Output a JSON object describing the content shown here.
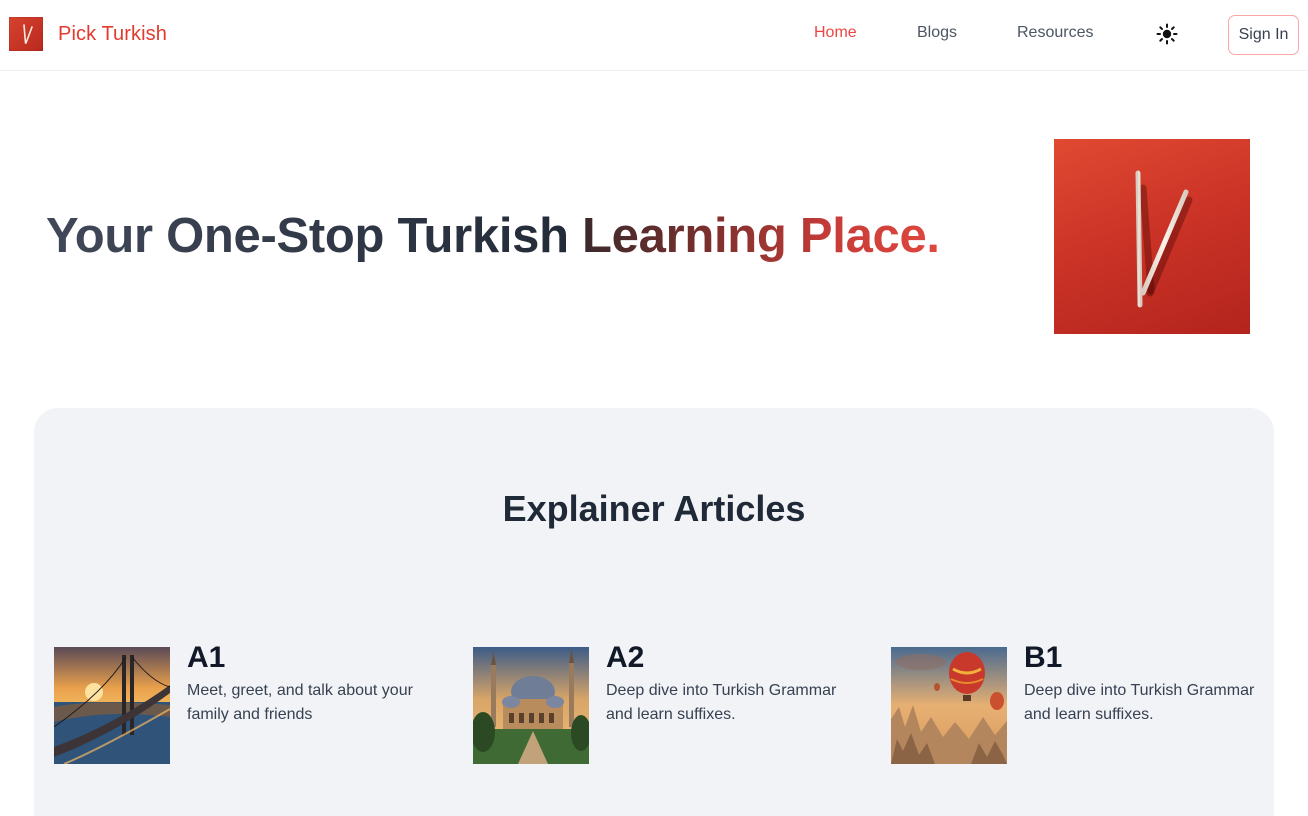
{
  "app": {
    "brand_name": "Pick Turkish",
    "accent_color": "#ef4444"
  },
  "nav": {
    "items": [
      {
        "label": "Home",
        "active": true
      },
      {
        "label": "Blogs",
        "active": false
      },
      {
        "label": "Resources",
        "active": false
      }
    ],
    "theme_toggle_icon": "sun-icon",
    "sign_in_label": "Sign In"
  },
  "hero": {
    "title_plain": "Your One-Stop Turkish ",
    "title_highlight": "Learning Place.",
    "image_icon": "chopsticks-logo-image"
  },
  "explainer": {
    "title": "Explainer Articles",
    "cards": [
      {
        "level": "A1",
        "description": "Meet, greet, and talk about your family and friends",
        "image": "bridge-sunset-image"
      },
      {
        "level": "A2",
        "description": "Deep dive into Turkish Grammar and learn suffixes.",
        "image": "mosque-image"
      },
      {
        "level": "B1",
        "description": "Deep dive into Turkish Grammar and learn suffixes.",
        "image": "hot-air-balloons-image"
      }
    ]
  }
}
